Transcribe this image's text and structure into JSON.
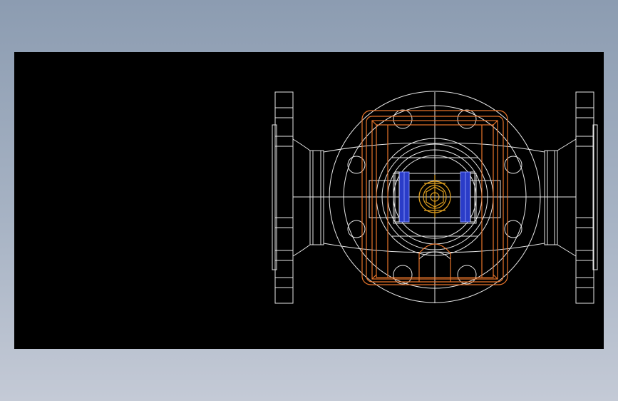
{
  "colors": {
    "background_top": "#8c9cb1",
    "background_bottom": "#c4cad6",
    "viewport": "#000000",
    "line_white": "#e6e6e6",
    "line_orange": "#e8742a",
    "line_gold": "#e0a020",
    "fill_blue": "#2a3cc8"
  },
  "drawing": {
    "subject": "valve-body-cad-view"
  }
}
